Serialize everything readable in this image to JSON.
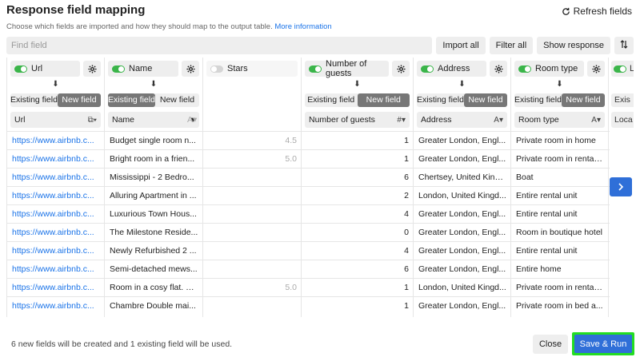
{
  "header": {
    "title": "Response field mapping",
    "refresh_label": "Refresh fields",
    "subtitle": "Choose which fields are imported and how they should map to the output table.",
    "more_info_link": "More information"
  },
  "toolbar": {
    "find_placeholder": "Find field",
    "import_all": "Import all",
    "filter_all": "Filter all",
    "show_response": "Show response"
  },
  "columns": [
    {
      "key": "url",
      "source": "Url",
      "enabled": true,
      "existing_label": "Existing field",
      "new_label": "New field",
      "mode": "new",
      "target": "Url",
      "type_icon": "link-icon"
    },
    {
      "key": "name",
      "source": "Name",
      "enabled": true,
      "existing_label": "Existing field",
      "new_label": "New field",
      "mode": "existing",
      "target": "Name",
      "type_icon": "text-type-icon"
    },
    {
      "key": "stars",
      "source": "Stars",
      "enabled": false
    },
    {
      "key": "guests",
      "source": "Number of guests",
      "enabled": true,
      "existing_label": "Existing field",
      "new_label": "New field",
      "mode": "new",
      "target": "Number of guests",
      "type_icon": "number-type-icon"
    },
    {
      "key": "address",
      "source": "Address",
      "enabled": true,
      "existing_label": "Existing field",
      "new_label": "New field",
      "mode": "new",
      "target": "Address",
      "type_icon": "text-type-icon"
    },
    {
      "key": "room",
      "source": "Room type",
      "enabled": true,
      "existing_label": "Existing field",
      "new_label": "New field",
      "mode": "new",
      "target": "Room type",
      "type_icon": "text-type-icon"
    },
    {
      "key": "loc",
      "source": "L",
      "enabled": true,
      "existing_label": "Exis",
      "target": "Loca"
    }
  ],
  "rows": [
    {
      "url": "https://www.airbnb.c...",
      "name": "Budget single room n...",
      "stars": "4.5",
      "guests": "1",
      "address": "Greater London, Engl...",
      "room": "Private room in home"
    },
    {
      "url": "https://www.airbnb.c...",
      "name": "Bright room in a frien...",
      "stars": "5.0",
      "guests": "1",
      "address": "Greater London, Engl...",
      "room": "Private room in rental ..."
    },
    {
      "url": "https://www.airbnb.c...",
      "name": "Mississippi - 2 Bedro...",
      "stars": "",
      "guests": "6",
      "address": "Chertsey, United King...",
      "room": "Boat"
    },
    {
      "url": "https://www.airbnb.c...",
      "name": "Alluring Apartment in ...",
      "stars": "",
      "guests": "2",
      "address": "London, United Kingd...",
      "room": "Entire rental unit"
    },
    {
      "url": "https://www.airbnb.c...",
      "name": "Luxurious Town Hous...",
      "stars": "",
      "guests": "4",
      "address": "Greater London, Engl...",
      "room": "Entire rental unit"
    },
    {
      "url": "https://www.airbnb.c...",
      "name": "The Milestone Reside...",
      "stars": "",
      "guests": "0",
      "address": "Greater London, Engl...",
      "room": "Room in boutique hotel"
    },
    {
      "url": "https://www.airbnb.c...",
      "name": "Newly Refurbished 2 ...",
      "stars": "",
      "guests": "4",
      "address": "Greater London, Engl...",
      "room": "Entire rental unit"
    },
    {
      "url": "https://www.airbnb.c...",
      "name": "Semi-detached mews...",
      "stars": "",
      "guests": "6",
      "address": "Greater London, Engl...",
      "room": "Entire home"
    },
    {
      "url": "https://www.airbnb.c...",
      "name": "Room in a cosy flat. C...",
      "stars": "5.0",
      "guests": "1",
      "address": "London, United Kingd...",
      "room": "Private room in rental ..."
    },
    {
      "url": "https://www.airbnb.c...",
      "name": "Chambre Double mai...",
      "stars": "",
      "guests": "1",
      "address": "Greater London, Engl...",
      "room": "Private room in bed a..."
    }
  ],
  "footer": {
    "summary": "6 new fields will be created and 1 existing field will be used.",
    "close_label": "Close",
    "run_label": "Save & Run"
  },
  "colors": {
    "accent": "#2f6fd8",
    "toggle_on": "#3bb54a",
    "highlight": "#22dd22"
  }
}
